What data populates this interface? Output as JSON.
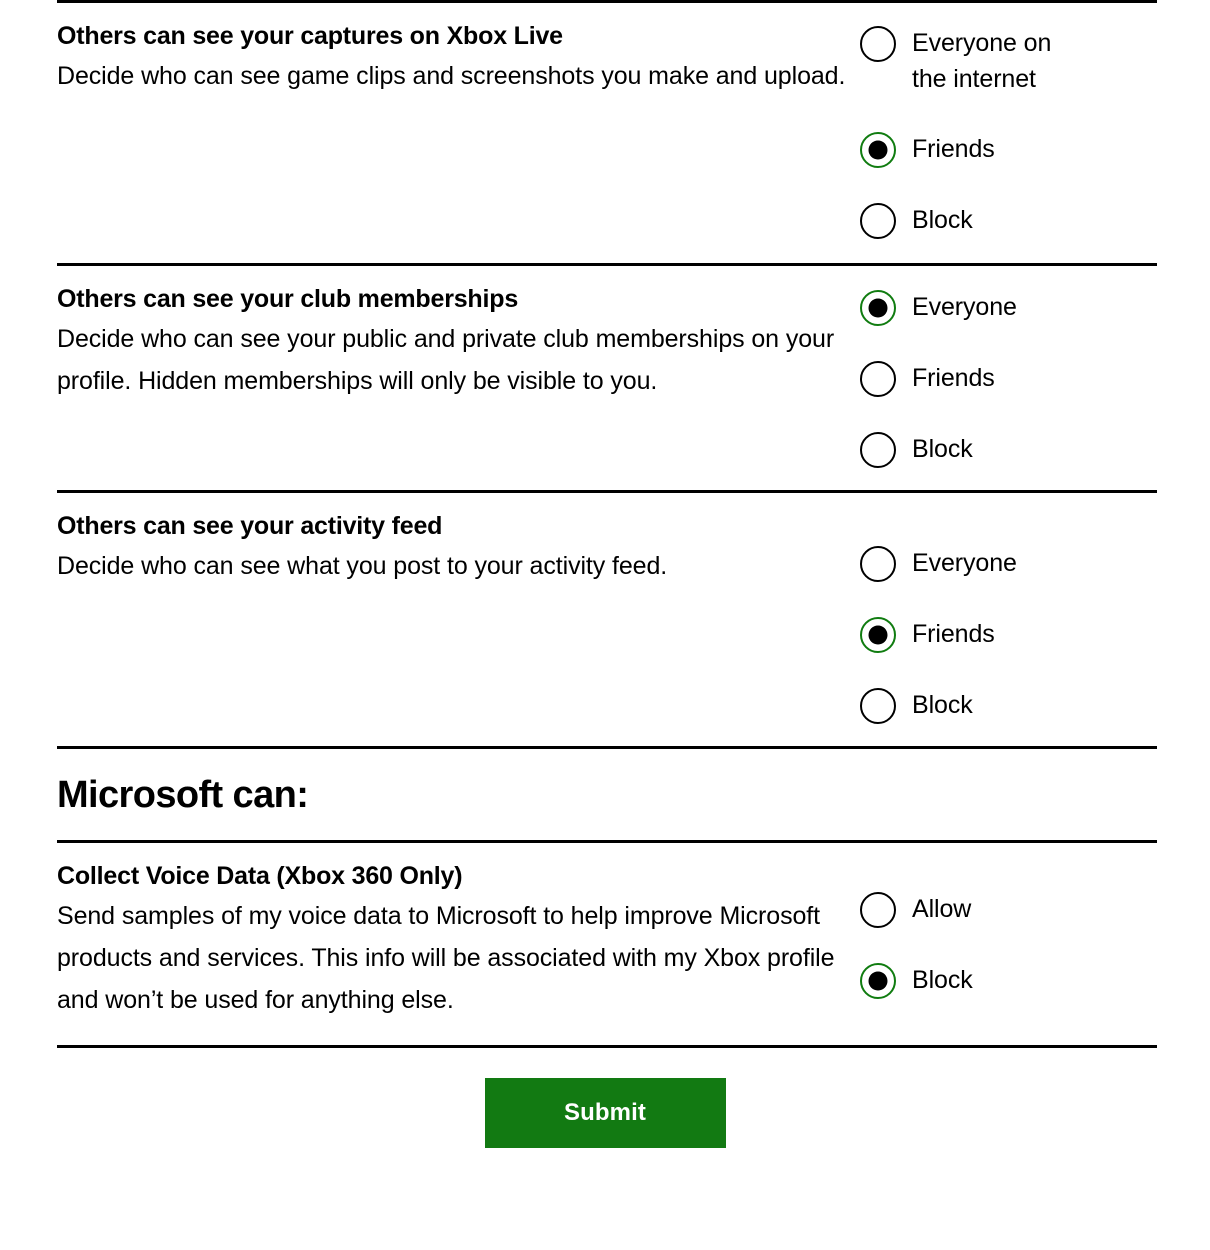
{
  "theme": {
    "accent_green": "#107C10",
    "submit_green": "#127A12",
    "text_color": "#000000",
    "background": "#ffffff"
  },
  "sections": [
    {
      "id": "captures",
      "title": "Others can see your captures on Xbox Live",
      "description": "Decide who can see game clips and screenshots you make and upload.",
      "options": [
        {
          "label": "Everyone on\nthe internet",
          "selected": false
        },
        {
          "label": "Friends",
          "selected": true
        },
        {
          "label": "Block",
          "selected": false
        }
      ]
    },
    {
      "id": "clubs",
      "title": "Others can see your club memberships",
      "description": "Decide who can see your public and private club memberships on your profile. Hidden memberships will only be visible to you.",
      "options": [
        {
          "label": "Everyone",
          "selected": true
        },
        {
          "label": "Friends",
          "selected": false
        },
        {
          "label": "Block",
          "selected": false
        }
      ]
    },
    {
      "id": "activity",
      "title": "Others can see your activity feed",
      "description": "Decide who can see what you post to your activity feed.",
      "options": [
        {
          "label": "Everyone",
          "selected": false
        },
        {
          "label": "Friends",
          "selected": true
        },
        {
          "label": "Block",
          "selected": false
        }
      ]
    }
  ],
  "microsoft_heading": "Microsoft can:",
  "microsoft_sections": [
    {
      "id": "voice",
      "title": "Collect Voice Data (Xbox 360 Only)",
      "description": "Send samples of my voice data to Microsoft to help improve Microsoft products and services. This info will be associated with my Xbox profile and won’t be used for anything else.",
      "options": [
        {
          "label": "Allow",
          "selected": false
        },
        {
          "label": "Block",
          "selected": true
        }
      ]
    }
  ],
  "submit": {
    "label": "Submit"
  }
}
